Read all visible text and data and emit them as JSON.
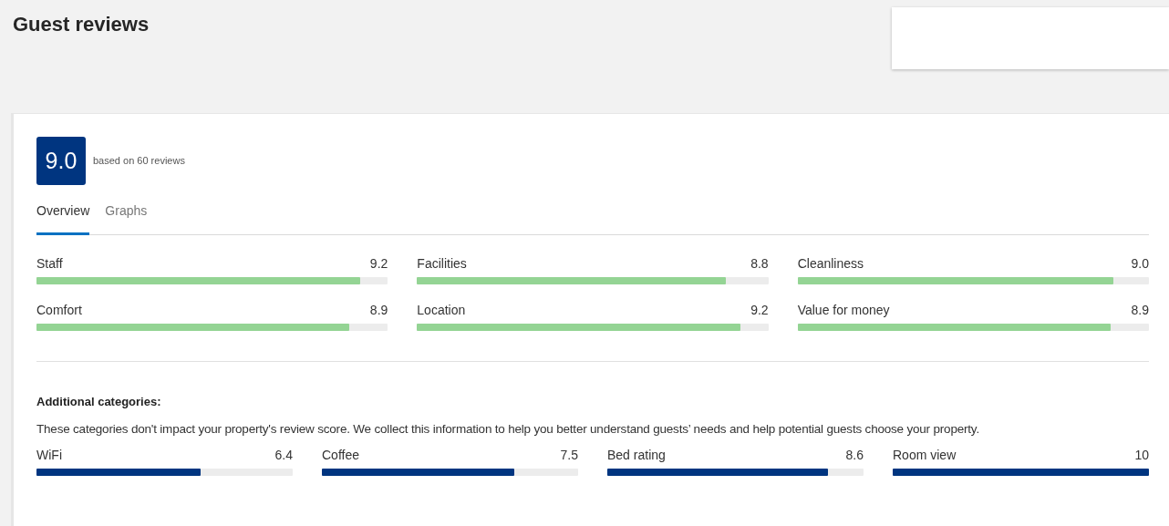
{
  "title": "Guest reviews",
  "score": {
    "value": "9.0",
    "caption": "based on 60 reviews"
  },
  "tabs": [
    {
      "label": "Overview",
      "selected": true
    },
    {
      "label": "Graphs",
      "selected": false
    }
  ],
  "categories": [
    {
      "name": "Staff",
      "score": "9.2",
      "level": 0.92
    },
    {
      "name": "Facilities",
      "score": "8.8",
      "level": 0.88
    },
    {
      "name": "Cleanliness",
      "score": "9.0",
      "level": 0.9
    },
    {
      "name": "Comfort",
      "score": "8.9",
      "level": 0.89
    },
    {
      "name": "Location",
      "score": "9.2",
      "level": 0.92
    },
    {
      "name": "Value for money",
      "score": "8.9",
      "level": 0.89
    }
  ],
  "additional": {
    "heading": "Additional categories:",
    "description": "These categories don't impact your property's review score. We collect this information to help you better understand guests’ needs and help potential guests choose your property.",
    "categories": [
      {
        "name": "WiFi",
        "score": "6.4",
        "level": 0.64
      },
      {
        "name": "Coffee",
        "score": "7.5",
        "level": 0.75
      },
      {
        "name": "Bed rating",
        "score": "8.6",
        "level": 0.86
      },
      {
        "name": "Room view",
        "score": "10",
        "level": 1.0
      }
    ]
  }
}
